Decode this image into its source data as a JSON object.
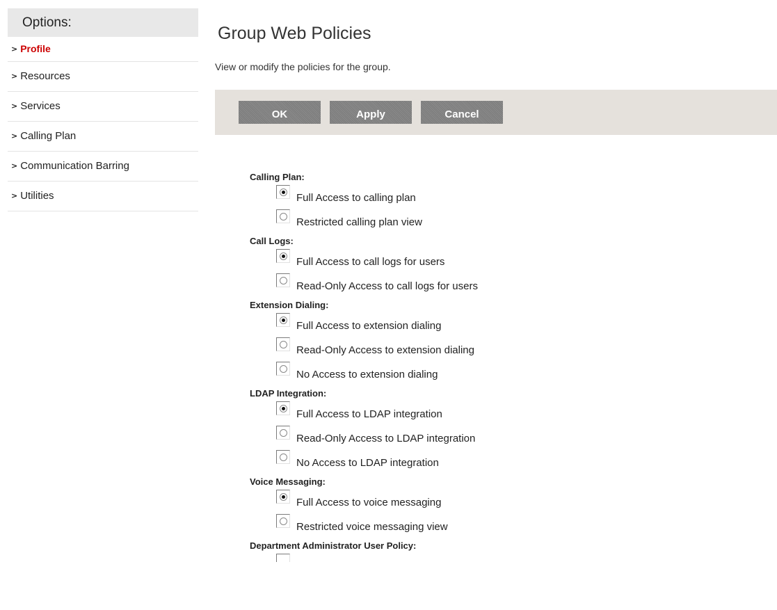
{
  "sidebar": {
    "header": "Options:",
    "items": [
      {
        "label": "Profile",
        "active": true
      },
      {
        "label": "Resources"
      },
      {
        "label": "Services"
      },
      {
        "label": "Calling Plan"
      },
      {
        "label": "Communication Barring"
      },
      {
        "label": "Utilities"
      }
    ]
  },
  "page": {
    "title": "Group Web Policies",
    "subtitle": "View or modify the policies for the group."
  },
  "toolbar": {
    "ok_label": "OK",
    "apply_label": "Apply",
    "cancel_label": "Cancel"
  },
  "policies": {
    "calling_plan": {
      "title": "Calling Plan:",
      "options": [
        {
          "label": "Full Access to calling plan",
          "checked": true
        },
        {
          "label": "Restricted calling plan view",
          "checked": false
        }
      ]
    },
    "call_logs": {
      "title": "Call Logs:",
      "options": [
        {
          "label": "Full Access to call logs for users",
          "checked": true
        },
        {
          "label": "Read-Only Access to call logs for users",
          "checked": false
        }
      ]
    },
    "extension_dialing": {
      "title": "Extension Dialing:",
      "options": [
        {
          "label": "Full Access to extension dialing",
          "checked": true
        },
        {
          "label": "Read-Only Access to extension dialing",
          "checked": false
        },
        {
          "label": "No Access to extension dialing",
          "checked": false
        }
      ]
    },
    "ldap_integration": {
      "title": "LDAP Integration:",
      "options": [
        {
          "label": "Full Access to LDAP integration",
          "checked": true
        },
        {
          "label": "Read-Only Access to LDAP integration",
          "checked": false
        },
        {
          "label": "No Access to LDAP integration",
          "checked": false
        }
      ]
    },
    "voice_messaging": {
      "title": "Voice Messaging:",
      "options": [
        {
          "label": "Full Access to voice messaging",
          "checked": true
        },
        {
          "label": "Restricted voice messaging view",
          "checked": false
        }
      ]
    },
    "department_admin": {
      "title": "Department Administrator User Policy:"
    }
  },
  "icons": {
    "sidebar_chevron": "chevron-right-icon",
    "radio": "radio-button-icon"
  }
}
